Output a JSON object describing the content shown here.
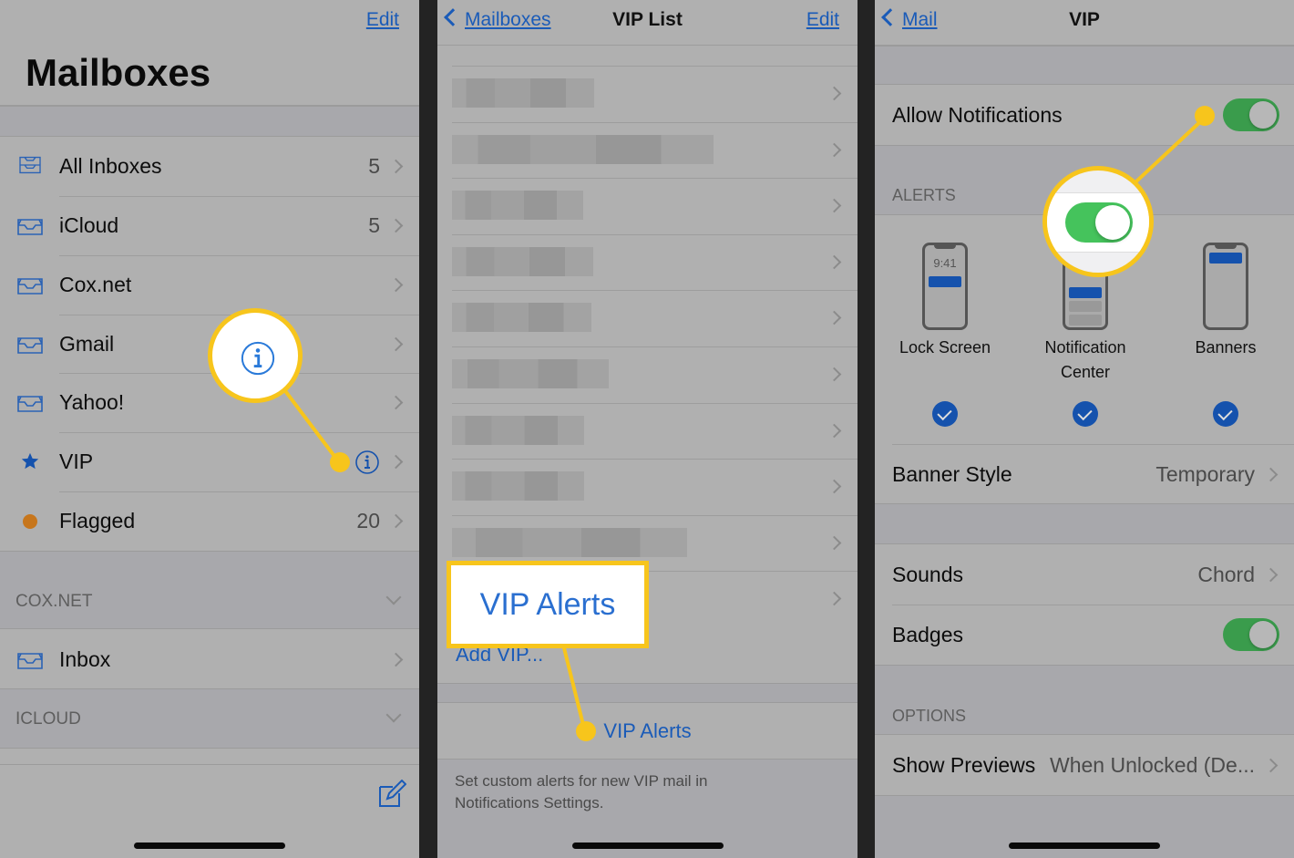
{
  "screen1": {
    "edit_label": "Edit",
    "title": "Mailboxes",
    "items": [
      {
        "label": "All Inboxes",
        "count": "5",
        "icon": "all-inboxes-tray-icon"
      },
      {
        "label": "iCloud",
        "count": "5",
        "icon": "inbox-tray-icon"
      },
      {
        "label": "Cox.net",
        "count": "",
        "icon": "inbox-tray-icon"
      },
      {
        "label": "Gmail",
        "count": "",
        "icon": "inbox-tray-icon"
      },
      {
        "label": "Yahoo!",
        "count": "",
        "icon": "inbox-tray-icon"
      },
      {
        "label": "VIP",
        "count": "",
        "icon": "star-icon"
      },
      {
        "label": "Flagged",
        "count": "20",
        "icon": "flag-dot-icon"
      }
    ],
    "sections": [
      {
        "header": "COX.NET",
        "items": [
          {
            "label": "Inbox",
            "icon": "inbox-tray-icon"
          }
        ]
      },
      {
        "header": "ICLOUD",
        "items": []
      }
    ],
    "compose_icon": "compose-icon",
    "info_icon": "info-icon"
  },
  "screen2": {
    "back_label": "Mailboxes",
    "title": "VIP List",
    "edit_label": "Edit",
    "vip_rows_count": 10,
    "add_vip_label": "Add VIP...",
    "vip_alerts_label": "VIP Alerts",
    "callout_label": "VIP Alerts",
    "footer_text_line1": "Set custom alerts for new VIP mail in",
    "footer_text_line2": "Notifications Settings."
  },
  "screen3": {
    "back_label": "Mail",
    "title": "VIP",
    "allow_notifications_label": "Allow Notifications",
    "allow_notifications_on": true,
    "alerts_header": "ALERTS",
    "alert_styles": [
      {
        "label": "Lock Screen",
        "checked": true,
        "preview_time": "9:41"
      },
      {
        "label": "Notification Center",
        "label_line1": "Notification",
        "label_line2": "Center",
        "checked": true
      },
      {
        "label": "Banners",
        "checked": true
      }
    ],
    "banner_style_label": "Banner Style",
    "banner_style_value": "Temporary",
    "sounds_label": "Sounds",
    "sounds_value": "Chord",
    "badges_label": "Badges",
    "badges_on": true,
    "options_header": "OPTIONS",
    "show_previews_label": "Show Previews",
    "show_previews_value": "When Unlocked (De..."
  },
  "colors": {
    "ios_blue": "#1a5bb8",
    "toggle_green": "#3a9c4c",
    "callout_yellow": "#f7c51c",
    "flag_orange": "#c7761c"
  }
}
